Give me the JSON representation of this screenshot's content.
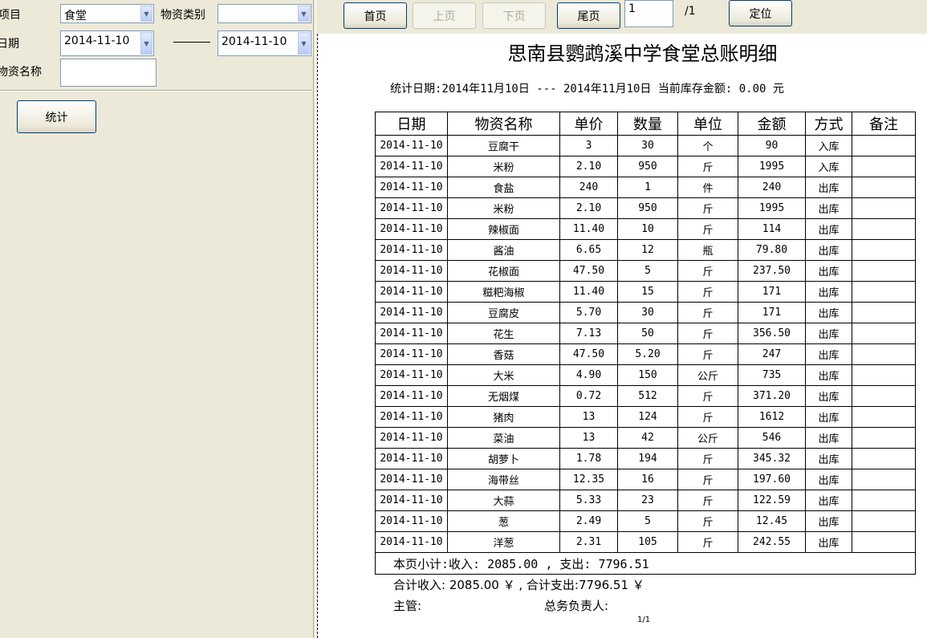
{
  "filters": {
    "project_label": "项目",
    "project_value": "食堂",
    "category_label": "物资类别",
    "category_value": "",
    "date_label": "日期",
    "date_from": "2014-11-10",
    "date_to": "2014-11-10",
    "item_name_label": "物资名称",
    "item_name_value": "",
    "stat_button": "统计"
  },
  "pager": {
    "first": "首页",
    "prev": "上页",
    "next": "下页",
    "last": "尾页",
    "page_input": "1",
    "page_total": "/1",
    "goto": "定位"
  },
  "report": {
    "title": "思南县鹦鹉溪中学食堂总账明细",
    "subtitle": "统计日期:2014年11月10日 --- 2014年11月10日   当前库存金额: 0.00 元",
    "headers": [
      "日期",
      "物资名称",
      "单价",
      "数量",
      "单位",
      "金额",
      "方式",
      "备注"
    ],
    "rows": [
      [
        "2014-11-10",
        "豆腐干",
        "3",
        "30",
        "个",
        "90",
        "入库",
        ""
      ],
      [
        "2014-11-10",
        "米粉",
        "2.10",
        "950",
        "斤",
        "1995",
        "入库",
        ""
      ],
      [
        "2014-11-10",
        "食盐",
        "240",
        "1",
        "件",
        "240",
        "出库",
        ""
      ],
      [
        "2014-11-10",
        "米粉",
        "2.10",
        "950",
        "斤",
        "1995",
        "出库",
        ""
      ],
      [
        "2014-11-10",
        "辣椒面",
        "11.40",
        "10",
        "斤",
        "114",
        "出库",
        ""
      ],
      [
        "2014-11-10",
        "酱油",
        "6.65",
        "12",
        "瓶",
        "79.80",
        "出库",
        ""
      ],
      [
        "2014-11-10",
        "花椒面",
        "47.50",
        "5",
        "斤",
        "237.50",
        "出库",
        ""
      ],
      [
        "2014-11-10",
        "糍粑海椒",
        "11.40",
        "15",
        "斤",
        "171",
        "出库",
        ""
      ],
      [
        "2014-11-10",
        "豆腐皮",
        "5.70",
        "30",
        "斤",
        "171",
        "出库",
        ""
      ],
      [
        "2014-11-10",
        "花生",
        "7.13",
        "50",
        "斤",
        "356.50",
        "出库",
        ""
      ],
      [
        "2014-11-10",
        "香菇",
        "47.50",
        "5.20",
        "斤",
        "247",
        "出库",
        ""
      ],
      [
        "2014-11-10",
        "大米",
        "4.90",
        "150",
        "公斤",
        "735",
        "出库",
        ""
      ],
      [
        "2014-11-10",
        "无烟煤",
        "0.72",
        "512",
        "斤",
        "371.20",
        "出库",
        ""
      ],
      [
        "2014-11-10",
        "猪肉",
        "13",
        "124",
        "斤",
        "1612",
        "出库",
        ""
      ],
      [
        "2014-11-10",
        "菜油",
        "13",
        "42",
        "公斤",
        "546",
        "出库",
        ""
      ],
      [
        "2014-11-10",
        "胡萝卜",
        "1.78",
        "194",
        "斤",
        "345.32",
        "出库",
        ""
      ],
      [
        "2014-11-10",
        "海带丝",
        "12.35",
        "16",
        "斤",
        "197.60",
        "出库",
        ""
      ],
      [
        "2014-11-10",
        "大蒜",
        "5.33",
        "23",
        "斤",
        "122.59",
        "出库",
        ""
      ],
      [
        "2014-11-10",
        "葱",
        "2.49",
        "5",
        "斤",
        "12.45",
        "出库",
        ""
      ],
      [
        "2014-11-10",
        "洋葱",
        "2.31",
        "105",
        "斤",
        "242.55",
        "出库",
        ""
      ]
    ],
    "page_subtotal": "本页小计:收入: 2085.00 ,   支出: 7796.51",
    "total_line": "合计收入: 2085.00 ￥  ,  合计支出:7796.51 ￥",
    "supervisor_label": "主管:",
    "manager_label": "总务负责人:",
    "page_number": "1/1"
  }
}
